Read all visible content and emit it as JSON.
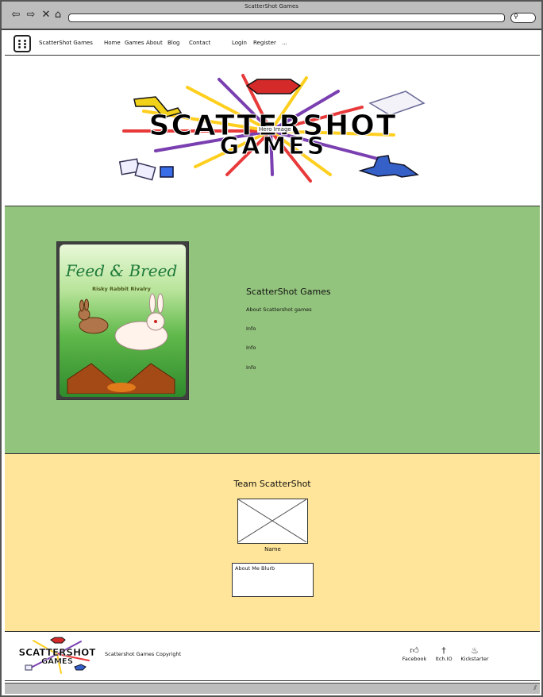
{
  "window": {
    "title": "ScatterShot Games"
  },
  "browser": {
    "url": "",
    "nav_icons": [
      "back-arrow-icon",
      "forward-arrow-icon",
      "close-icon",
      "home-icon"
    ]
  },
  "nav": {
    "brand": "ScatterShot Games",
    "links": [
      "Home",
      "Games",
      "About",
      "Blog",
      "Contact"
    ],
    "login": "Login",
    "register": "Register",
    "more": "..."
  },
  "hero": {
    "label": "Hero Image",
    "logo_text_line1": "SCATTERSHOT",
    "logo_text_line2": "GAMES"
  },
  "about": {
    "card_title": "Feed & Breed",
    "card_subtitle": "Risky Rabbit Rivalry",
    "title": "ScatterShot Games",
    "subtitle": "About Scattershot games",
    "info": [
      "Info",
      "Info",
      "Info"
    ]
  },
  "team": {
    "title": "Team ScatterShot",
    "member_name": "Name",
    "blurb": "About Me Blurb"
  },
  "footer": {
    "logo_line1": "SCATTERSHOT",
    "logo_line2": "GAMES",
    "copyright": "Scattershot Games Copyright",
    "social": [
      {
        "icon": "thumbs-up-icon",
        "label": "Facebook"
      },
      {
        "icon": "dagger-icon",
        "label": "Itch.IO"
      },
      {
        "icon": "flame-icon",
        "label": "Kickstarter"
      }
    ]
  },
  "colors": {
    "green_section": "#93c47d",
    "yellow_section": "#ffe599",
    "chrome": "#bdbdbd"
  }
}
